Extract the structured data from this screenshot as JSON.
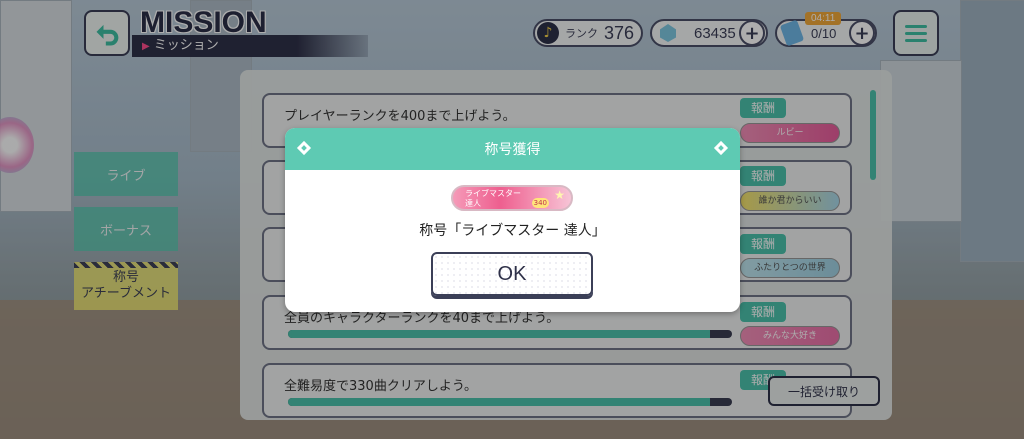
{
  "header": {
    "title_en": "MISSION",
    "title_jp": "ミッション",
    "rank_label": "ランク",
    "rank_value": "376",
    "gem_count": "63435",
    "ticket_timer": "04:11",
    "ticket_count": "0/10",
    "icons": {
      "back": "back-arrow-icon",
      "menu": "hamburger-menu-icon",
      "rank": "music-note-icon",
      "gem": "crystal-icon",
      "ticket": "ticket-icon",
      "plus": "plus-icon"
    }
  },
  "tabs": [
    {
      "label": "ライブ"
    },
    {
      "label": "ボーナス"
    },
    {
      "label": "称号\nアチーブメント"
    }
  ],
  "missions": [
    {
      "text": "プレイヤーランクを400まで上げよう。",
      "reward_label": "報酬",
      "reward_title": "ルビー",
      "progress": null
    },
    {
      "text": "",
      "reward_label": "報酬",
      "reward_title": "誰か君からいい",
      "progress": null
    },
    {
      "text": "",
      "reward_label": "報酬",
      "reward_title": "ふたりとつの世界",
      "progress": null
    },
    {
      "text": "全員のキャラクターランクを40まで上げよう。",
      "reward_label": "報酬",
      "reward_title": "みんな大好き",
      "progress": 0.95
    },
    {
      "text": "全難易度で330曲クリアしよう。",
      "reward_label": "報酬",
      "reward_title": "",
      "progress": 0.95
    }
  ],
  "bulk_receive_label": "一括受け取り",
  "modal": {
    "title": "称号獲得",
    "badge_text": "ライブマスター\n達人",
    "badge_number": "340",
    "message": "称号「ライブマスター 達人」",
    "ok_label": "OK"
  },
  "colors": {
    "accent": "#5ecab3",
    "dark": "#2f3149",
    "pink": "#ee5f8f"
  }
}
